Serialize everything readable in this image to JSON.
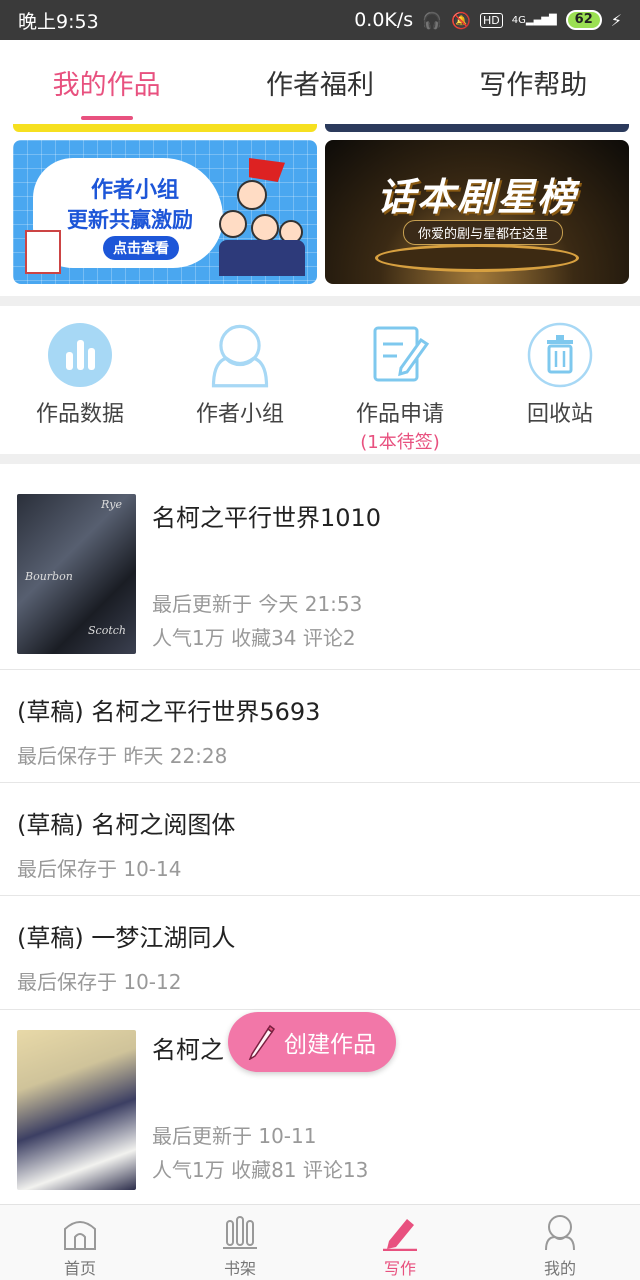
{
  "status_bar": {
    "time": "晚上9:53",
    "speed": "0.0K/s",
    "network": "4G",
    "hd": "HD",
    "battery": "62"
  },
  "tabs": [
    {
      "label": "我的作品",
      "active": true
    },
    {
      "label": "作者福利",
      "active": false
    },
    {
      "label": "写作帮助",
      "active": false
    }
  ],
  "banners": {
    "left": {
      "line1": "作者小组",
      "line2": "更新共赢激励",
      "button": "点击查看"
    },
    "right": {
      "title": "话本剧星榜",
      "subtitle": "你爱的剧与星都在这里"
    }
  },
  "quick_actions": [
    {
      "label": "作品数据",
      "icon": "bar-chart-icon"
    },
    {
      "label": "作者小组",
      "icon": "group-icon"
    },
    {
      "label": "作品申请",
      "sub": "(1本待签)",
      "icon": "edit-document-icon"
    },
    {
      "label": "回收站",
      "icon": "trash-icon"
    }
  ],
  "works": [
    {
      "type": "published",
      "title": "名柯之平行世界1010",
      "updated": "最后更新于 今天 21:53",
      "stats": "人气1万 收藏34 评论2",
      "cover_texts": [
        "Rye",
        "Bourbon",
        "Scotch"
      ]
    },
    {
      "type": "draft",
      "title": "(草稿) 名柯之平行世界5693",
      "saved": "最后保存于 昨天 22:28"
    },
    {
      "type": "draft",
      "title": "(草稿) 名柯之阅图体",
      "saved": "最后保存于 10-14"
    },
    {
      "type": "draft",
      "title": "(草稿) 一梦江湖同人",
      "saved": "最后保存于 10-12"
    },
    {
      "type": "published",
      "title": "名柯之",
      "updated": "最后更新于 10-11",
      "stats": "人气1万 收藏81 评论13"
    }
  ],
  "fab": {
    "label": "创建作品",
    "icon": "pencil-icon"
  },
  "bottom_nav": [
    {
      "label": "首页",
      "icon": "home-icon",
      "active": false
    },
    {
      "label": "书架",
      "icon": "bookshelf-icon",
      "active": false
    },
    {
      "label": "写作",
      "icon": "pen-icon",
      "active": true
    },
    {
      "label": "我的",
      "icon": "profile-icon",
      "active": false
    }
  ],
  "colors": {
    "accent": "#e8517f",
    "fab": "#f277a8",
    "icon_blue": "#7ec8ee"
  }
}
